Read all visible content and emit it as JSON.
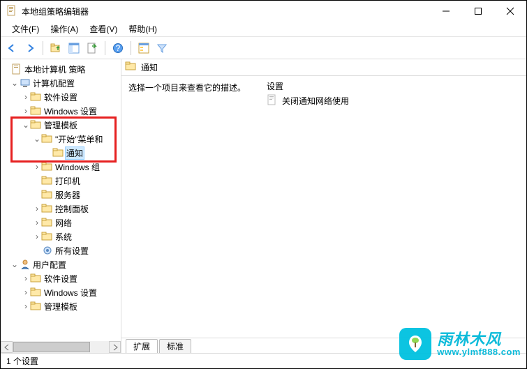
{
  "window": {
    "title": "本地组策略编辑器"
  },
  "menu": {
    "file": "文件(F)",
    "action": "操作(A)",
    "view": "查看(V)",
    "help": "帮助(H)"
  },
  "tree": {
    "root": "本地计算机 策略",
    "computer_config": "计算机配置",
    "cc_software": "软件设置",
    "cc_windows": "Windows 设置",
    "cc_admin": "管理模板",
    "cc_start": "\"开始\"菜单和",
    "cc_notify": "通知",
    "cc_wincomp": "Windows 组",
    "cc_printer": "打印机",
    "cc_server": "服务器",
    "cc_ctrlpanel": "控制面板",
    "cc_network": "网络",
    "cc_system": "系统",
    "cc_all": "所有设置",
    "user_config": "用户配置",
    "uc_software": "软件设置",
    "uc_windows": "Windows 设置",
    "uc_admin": "管理模板"
  },
  "detail": {
    "header": "通知",
    "hint": "选择一个项目来查看它的描述。",
    "col_setting": "设置",
    "item1": "关闭通知网络使用"
  },
  "tabs": {
    "extended": "扩展",
    "standard": "标准"
  },
  "status": {
    "text": "1 个设置"
  },
  "watermark": {
    "cn": "雨林木风",
    "en": "www.ylmf888.com"
  }
}
